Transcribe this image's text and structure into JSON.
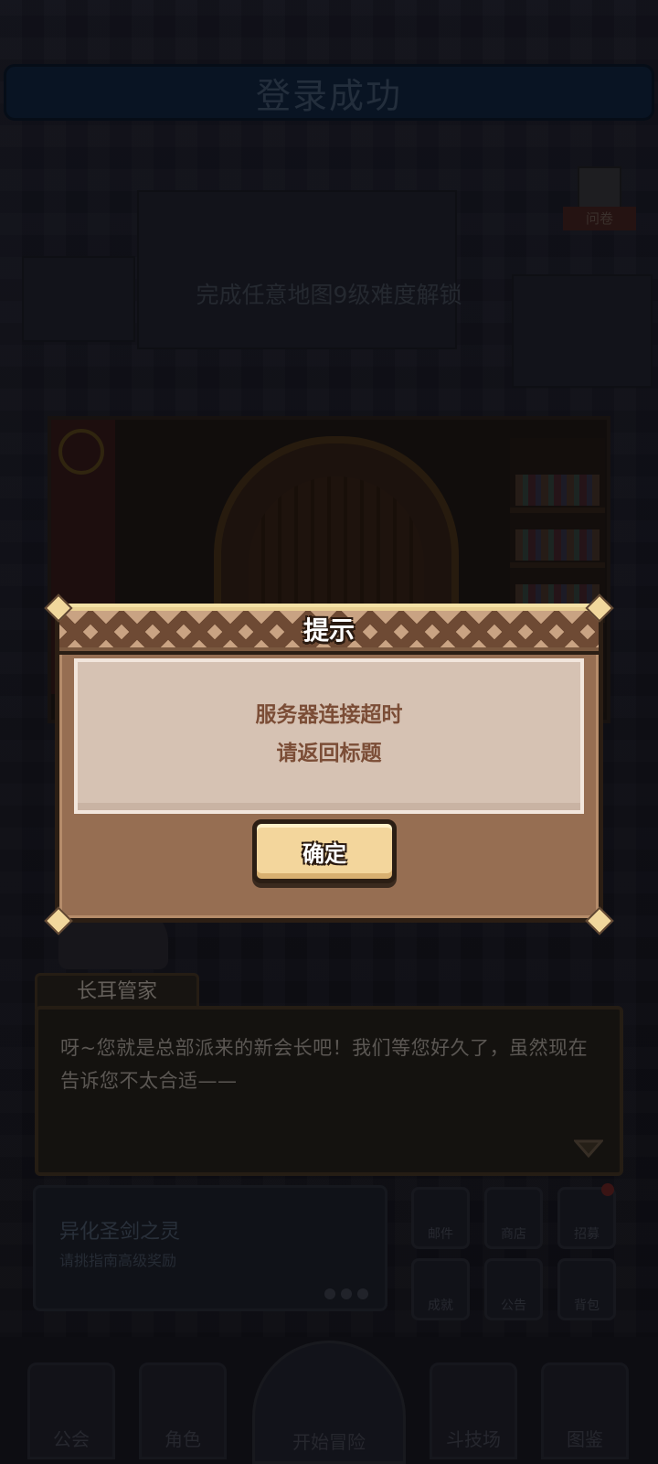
{
  "background": {
    "login_banner": "登录成功",
    "unlock_hint": "完成任意地图9级难度解锁",
    "questionnaire_label": "问卷",
    "speaker_name": "长耳管家",
    "dialogue_text": "呀~您就是总部派来的新会长吧！我们等您好久了，虽然现在告诉您不太合适——",
    "event": {
      "title": "异化圣剑之灵",
      "subtitle": "请挑指南高级奖励"
    },
    "grid_buttons": [
      "邮件",
      "商店",
      "招募",
      "成就",
      "公告",
      "背包"
    ],
    "nav": [
      "公会",
      "角色",
      "开始冒险",
      "斗技场",
      "图鉴"
    ]
  },
  "dialog": {
    "title": "提示",
    "message_line1": "服务器连接超时",
    "message_line2": "请返回标题",
    "confirm_label": "确定"
  },
  "colors": {
    "dialog_frame": "#966e52",
    "dialog_body": "#d6c2b3",
    "message_text": "#7b4d36",
    "button_fill": "#f3d69c"
  }
}
